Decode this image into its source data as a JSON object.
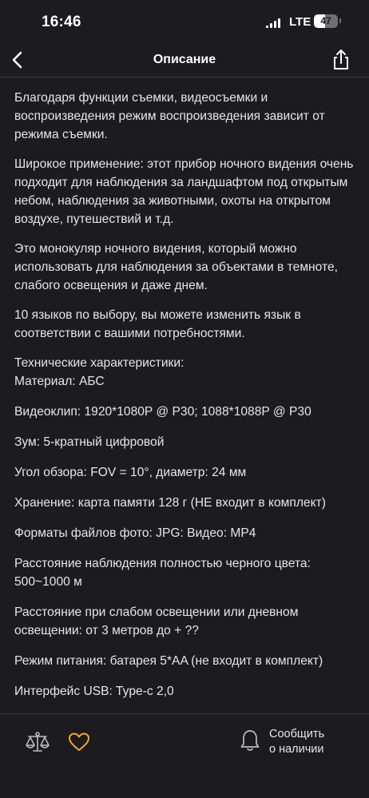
{
  "status_bar": {
    "time": "16:46",
    "network": "LTE",
    "battery_level": "47",
    "battery_fraction": 0.47
  },
  "nav": {
    "title": "Описание",
    "back_icon": "chevron-left-icon",
    "share_icon": "share-icon"
  },
  "description": {
    "paragraphs": [
      "Благодаря функции съемки, видеосъемки и воспроизведения режим воспроизведения зависит от режима съемки.",
      "Широкое применение: этот прибор ночного видения очень подходит для наблюдения за ландшафтом под открытым небом, наблюдения за животными, охоты на открытом воздухе, путешествий и т.д.",
      "Это монокуляр ночного видения, который можно использовать для наблюдения за объектами в темноте, слабого освещения и даже днем.",
      "10 языков по выбору, вы можете изменить язык в соответствии с вашими потребностями."
    ],
    "specs_heading": "Технические характеристики:",
    "specs": [
      "Материал: АБС",
      "Видеоклип: 1920*1080P @ P30; 1088*1088P @ P30",
      "Зум: 5-кратный цифровой",
      "Угол обзора: FOV = 10°, диаметр: 24 мм",
      "Хранение: карта памяти 128 г (НЕ входит в комплект)",
      "Форматы файлов фото: JPG: Видео: MP4",
      "Расстояние наблюдения полностью черного цвета: 500~1000 м",
      "Расстояние при слабом освещении или дневном освещении: от 3 метров до + ??",
      "Режим питания: батарея 5*AA (не входит в комплект)",
      "Интерфейс USB: Type-c 2,0"
    ]
  },
  "bottom_bar": {
    "compare_icon": "scales-icon",
    "favorite_icon": "heart-icon",
    "notify_icon": "bell-icon",
    "notify_label_line1": "Сообщить",
    "notify_label_line2": "о наличии",
    "accent_color": "#f5a623"
  }
}
